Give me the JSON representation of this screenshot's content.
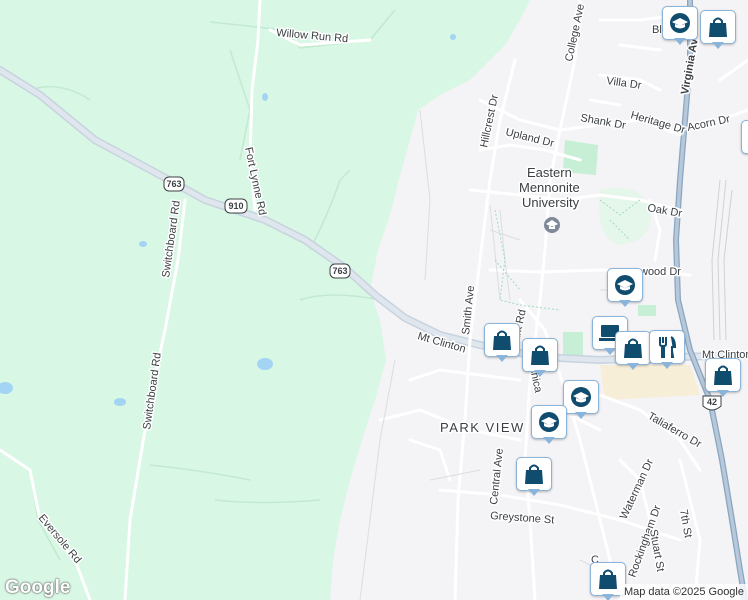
{
  "map": {
    "attribution": "Map data ©2025 Google",
    "logo": "Google",
    "colors": {
      "park": "#d8f7e4",
      "land": "#f4f3f6",
      "road": "#ffffff",
      "highway": "#c7d3df",
      "water": "#a3d4f3",
      "marker_fill": "#0f4c6e",
      "marker_border": "#8ab4d9"
    }
  },
  "labels": {
    "willow_run": "Willow Run Rd",
    "fort_lynne": "Fort Lynne Rd",
    "switchboard_1": "Switchboard Rd",
    "switchboard_2": "Switchboard Rd",
    "eversole": "Eversole Rd",
    "mt_clinton": "Mt Clinton",
    "mt_clinton_2": "Mt Clinton",
    "college_ave": "College Ave",
    "villa": "Villa Dr",
    "shank": "Shank Dr",
    "heritage": "Heritage Dr",
    "acorn": "Acorn Dr",
    "hillcrest": "Hillcrest Dr",
    "upland": "Upland Dr",
    "oak": "Oak Dr",
    "wood": "wood Dr",
    "smith": "Smith Ave",
    "park_rd": "ark Rd",
    "chica": "chica",
    "park_view": "PARK VIEW",
    "central": "Central Ave",
    "taliaferro": "Taliaferro Dr",
    "waterman": "Waterman Dr",
    "rockingham": "Rockingham Dr",
    "stuart": "Stuart St",
    "seventh": "7th St",
    "greystone": "Greystone St",
    "virginia": "Virginia Av",
    "university_1": "Eastern",
    "university_2": "Mennonite",
    "university_3": "University",
    "bl": "Bl",
    "c": "C"
  },
  "shields": [
    {
      "id": "763-a",
      "text": "763"
    },
    {
      "id": "910",
      "text": "910"
    },
    {
      "id": "763-b",
      "text": "763"
    },
    {
      "id": "42",
      "text": "42"
    }
  ],
  "markers": [
    {
      "id": "school-top",
      "icon": "school-icon"
    },
    {
      "id": "shop-top",
      "icon": "shopping-bag-icon"
    },
    {
      "id": "school-mid",
      "icon": "school-icon"
    },
    {
      "id": "shop-mid-1",
      "icon": "shopping-bag-icon"
    },
    {
      "id": "shop-mid-2",
      "icon": "shopping-bag-icon"
    },
    {
      "id": "laptop",
      "icon": "laptop-icon"
    },
    {
      "id": "shop-mid-3",
      "icon": "shopping-bag-icon"
    },
    {
      "id": "restaurant",
      "icon": "restaurant-icon"
    },
    {
      "id": "shop-right",
      "icon": "shopping-bag-icon"
    },
    {
      "id": "school-low-1",
      "icon": "school-icon"
    },
    {
      "id": "school-low-2",
      "icon": "school-icon"
    },
    {
      "id": "shop-low",
      "icon": "shopping-bag-icon"
    },
    {
      "id": "shop-bottom",
      "icon": "shopping-bag-icon"
    }
  ]
}
